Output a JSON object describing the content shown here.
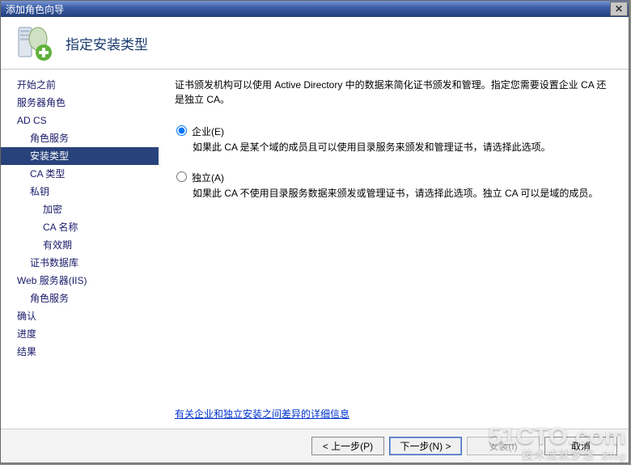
{
  "window": {
    "title": "添加角色向导",
    "close_glyph": "✕"
  },
  "header": {
    "title": "指定安装类型"
  },
  "sidebar": {
    "items": [
      {
        "label": "开始之前",
        "indent": 0,
        "selected": false
      },
      {
        "label": "服务器角色",
        "indent": 0,
        "selected": false
      },
      {
        "label": "AD CS",
        "indent": 0,
        "selected": false
      },
      {
        "label": "角色服务",
        "indent": 1,
        "selected": false
      },
      {
        "label": "安装类型",
        "indent": 1,
        "selected": true
      },
      {
        "label": "CA 类型",
        "indent": 1,
        "selected": false
      },
      {
        "label": "私钥",
        "indent": 1,
        "selected": false
      },
      {
        "label": "加密",
        "indent": 2,
        "selected": false
      },
      {
        "label": "CA 名称",
        "indent": 2,
        "selected": false
      },
      {
        "label": "有效期",
        "indent": 2,
        "selected": false
      },
      {
        "label": "证书数据库",
        "indent": 1,
        "selected": false
      },
      {
        "label": "Web 服务器(IIS)",
        "indent": 0,
        "selected": false
      },
      {
        "label": "角色服务",
        "indent": 1,
        "selected": false
      },
      {
        "label": "确认",
        "indent": 0,
        "selected": false
      },
      {
        "label": "进度",
        "indent": 0,
        "selected": false
      },
      {
        "label": "结果",
        "indent": 0,
        "selected": false
      }
    ]
  },
  "content": {
    "intro": "证书颁发机构可以使用 Active Directory 中的数据来简化证书颁发和管理。指定您需要设置企业 CA 还是独立 CA。",
    "options": [
      {
        "value": "enterprise",
        "label": "企业(E)",
        "desc": "如果此 CA 是某个域的成员且可以使用目录服务来颁发和管理证书，请选择此选项。",
        "checked": true
      },
      {
        "value": "standalone",
        "label": "独立(A)",
        "desc": "如果此 CA 不使用目录服务数据来颁发或管理证书，请选择此选项。独立 CA 可以是域的成员。",
        "checked": false
      }
    ],
    "more_link": "有关企业和独立安装之间差异的详细信息"
  },
  "footer": {
    "prev": "< 上一步(P)",
    "next": "下一步(N) >",
    "install": "安装(I)",
    "cancel": "取消"
  },
  "watermark": {
    "main": "51CTO.com",
    "sub": "技术成就梦想",
    "blog": "Blog"
  },
  "icons": {
    "server": "server-with-green-plus"
  }
}
